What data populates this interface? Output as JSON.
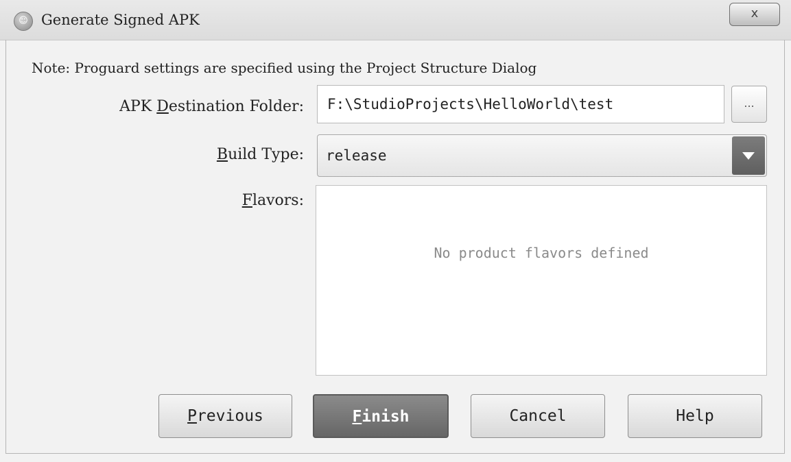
{
  "window": {
    "title": "Generate Signed APK",
    "close_label": "x"
  },
  "note": "Note: Proguard settings are specified using the Project Structure Dialog",
  "destination": {
    "label_pre": "APK ",
    "label_mnemonic": "D",
    "label_post": "estination Folder:",
    "value": "F:\\StudioProjects\\HelloWorld\\test",
    "browse_label": "..."
  },
  "build_type": {
    "label_mnemonic": "B",
    "label_post": "uild Type:",
    "value": "release"
  },
  "flavors": {
    "label_mnemonic": "F",
    "label_post": "lavors:",
    "empty_text": "No product flavors defined"
  },
  "buttons": {
    "previous_mnemonic": "P",
    "previous_rest": "revious",
    "finish_mnemonic": "F",
    "finish_rest": "inish",
    "cancel": "Cancel",
    "help": "Help"
  },
  "colors": {
    "primary_button": "#6f6f6f",
    "dropdown_arrow": "#6a6a6a",
    "window_bg": "#f2f2f2"
  },
  "icons": [
    "app-icon",
    "close-icon",
    "ellipsis-icon",
    "chevron-down-icon"
  ]
}
